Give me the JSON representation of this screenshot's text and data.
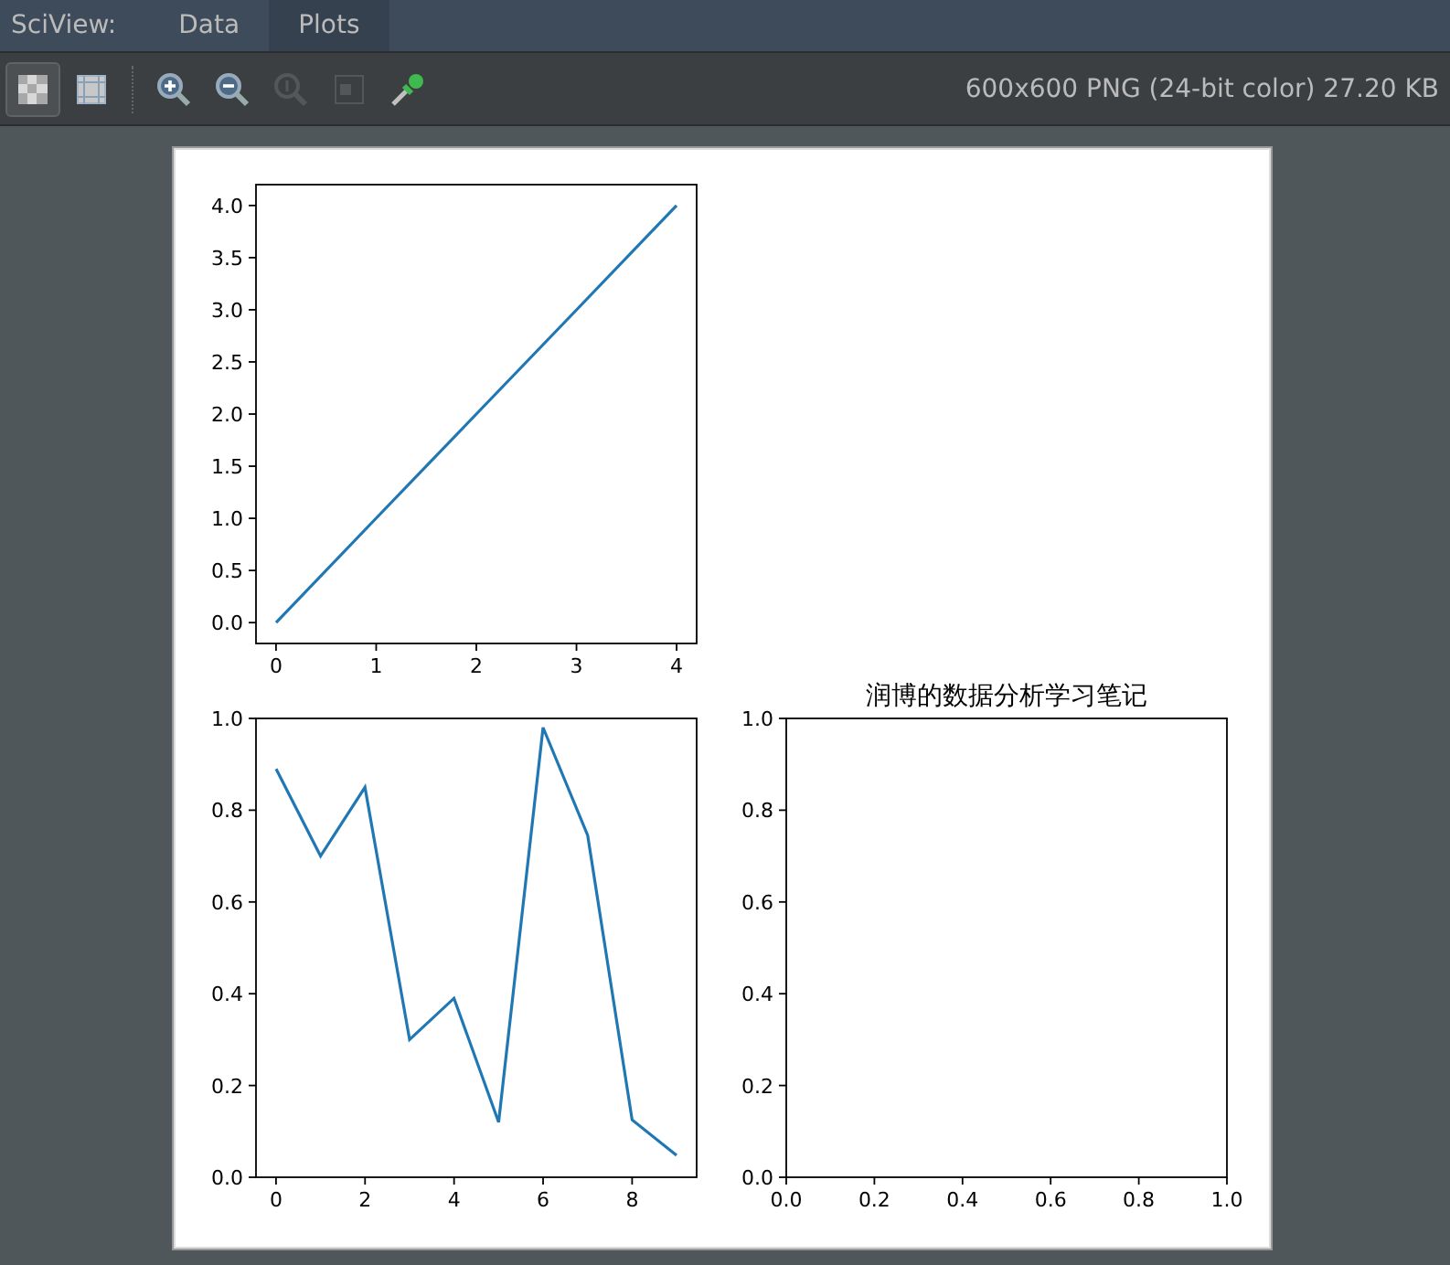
{
  "viewer": {
    "label": "SciView:",
    "tabs": [
      {
        "label": "Data",
        "selected": false
      },
      {
        "label": "Plots",
        "selected": true
      }
    ]
  },
  "toolbar": {
    "tools": [
      {
        "kind": "checker",
        "selected": true,
        "disabled": false
      },
      {
        "kind": "grid",
        "selected": false,
        "disabled": false
      },
      {
        "kind": "zoom-in",
        "selected": false,
        "disabled": false
      },
      {
        "kind": "zoom-out",
        "selected": false,
        "disabled": false
      },
      {
        "kind": "actual-size",
        "selected": false,
        "disabled": true
      },
      {
        "kind": "fit",
        "selected": false,
        "disabled": true
      },
      {
        "kind": "picker",
        "selected": false,
        "disabled": false
      }
    ],
    "image_info": "600x600 PNG (24-bit color) 27.20 KB"
  },
  "figure": {
    "plots": [
      {
        "chart_data": {
          "type": "line",
          "x": [
            0,
            1,
            2,
            3,
            4
          ],
          "series": [
            {
              "color": "#1f77b4",
              "values": [
                0,
                1,
                2,
                3,
                4
              ]
            }
          ],
          "xlim": [
            -0.2,
            4.2
          ],
          "ylim": [
            -0.2,
            4.2
          ],
          "xticks": [
            {
              "value": 0,
              "label": "0"
            },
            {
              "value": 1,
              "label": "1"
            },
            {
              "value": 2,
              "label": "2"
            },
            {
              "value": 3,
              "label": "3"
            },
            {
              "value": 4,
              "label": "4"
            }
          ],
          "yticks": [
            {
              "value": 0,
              "label": "0.0"
            },
            {
              "value": 0.5,
              "label": "0.5"
            },
            {
              "value": 1,
              "label": "1.0"
            },
            {
              "value": 1.5,
              "label": "1.5"
            },
            {
              "value": 2,
              "label": "2.0"
            },
            {
              "value": 2.5,
              "label": "2.5"
            },
            {
              "value": 3,
              "label": "3.0"
            },
            {
              "value": 3.5,
              "label": "3.5"
            },
            {
              "value": 4,
              "label": "4.0"
            }
          ]
        }
      },
      {
        "chart_data": {
          "type": "line",
          "x": [
            0,
            1,
            2,
            3,
            4,
            5,
            6,
            7,
            8,
            9
          ],
          "series": [
            {
              "color": "#1f77b4",
              "values": [
                0.89,
                0.7,
                0.85,
                0.3,
                0.39,
                0.12,
                0.98,
                0.745,
                0.125,
                0.048
              ]
            }
          ],
          "xlim": [
            -0.45,
            9.45
          ],
          "ylim": [
            0,
            1
          ],
          "xticks": [
            {
              "value": 0,
              "label": "0"
            },
            {
              "value": 2,
              "label": "2"
            },
            {
              "value": 4,
              "label": "4"
            },
            {
              "value": 6,
              "label": "6"
            },
            {
              "value": 8,
              "label": "8"
            }
          ],
          "yticks": [
            {
              "value": 0,
              "label": "0.0"
            },
            {
              "value": 0.2,
              "label": "0.2"
            },
            {
              "value": 0.4,
              "label": "0.4"
            },
            {
              "value": 0.6,
              "label": "0.6"
            },
            {
              "value": 0.8,
              "label": "0.8"
            },
            {
              "value": 1,
              "label": "1.0"
            }
          ]
        }
      },
      {
        "chart_data": {
          "type": "line",
          "title": "润博的数据分析学习笔记",
          "xlim": [
            0,
            1
          ],
          "ylim": [
            0,
            1
          ],
          "xticks": [
            {
              "value": 0,
              "label": "0.0"
            },
            {
              "value": 0.2,
              "label": "0.2"
            },
            {
              "value": 0.4,
              "label": "0.4"
            },
            {
              "value": 0.6,
              "label": "0.6"
            },
            {
              "value": 0.8,
              "label": "0.8"
            },
            {
              "value": 1,
              "label": "1.0"
            }
          ],
          "yticks": [
            {
              "value": 0,
              "label": "0.0"
            },
            {
              "value": 0.2,
              "label": "0.2"
            },
            {
              "value": 0.4,
              "label": "0.4"
            },
            {
              "value": 0.6,
              "label": "0.6"
            },
            {
              "value": 0.8,
              "label": "0.8"
            },
            {
              "value": 1,
              "label": "1.0"
            }
          ]
        }
      }
    ]
  }
}
